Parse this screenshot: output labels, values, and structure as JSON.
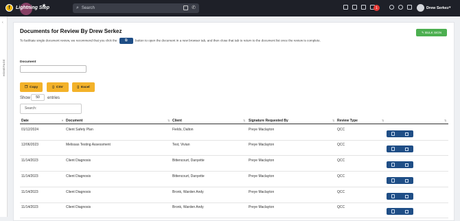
{
  "app": {
    "brand": "Lightning Step",
    "logo_letter": "f"
  },
  "search": {
    "placeholder": "Search"
  },
  "user": {
    "name": "Drew Serkez"
  },
  "notifications": {
    "count": "1"
  },
  "sidebar": {
    "label": "HOMEPAGE"
  },
  "page": {
    "title": "Documents for Review By Drew Serkez",
    "bulk_label": "BULK SIGN",
    "instruction_before": "To facilitate single document review, we recommend that you click the",
    "instruction_after": "button to open the document in a new browser tab, and then close that tab to return to the document list once the review is complete.",
    "document_label": "Document",
    "buttons": {
      "copy": "Copy",
      "csv": "CSV",
      "excel": "Excel"
    },
    "show_label": "Show",
    "show_value": "50",
    "entries_label": "entries",
    "table_search_label": "Search:"
  },
  "table": {
    "columns": [
      "Date",
      "Document",
      "Client",
      "Signature Requested By",
      "Review Type"
    ],
    "rows": [
      {
        "date": "01/12/2024",
        "document": "Client Safety Plan",
        "client": "Fields, Dalton",
        "requested_by": "Preye Maclayton",
        "review_type": "QCC"
      },
      {
        "date": "12/06/2023",
        "document": "Melissas Testing Assessment",
        "client": "Test, Vivian",
        "requested_by": "Preye Maclayton",
        "review_type": "QCC"
      },
      {
        "date": "11/14/2023",
        "document": "Client Diagnosis",
        "client": "Bittencourt, Danyette",
        "requested_by": "Preye Maclayton",
        "review_type": "QCC"
      },
      {
        "date": "11/14/2023",
        "document": "Client Diagnosis",
        "client": "Bittencourt, Danyette",
        "requested_by": "Preye Maclayton",
        "review_type": "QCC"
      },
      {
        "date": "11/14/2023",
        "document": "Client Diagnosis",
        "client": "Bronk, Warden Andy",
        "requested_by": "Preye Maclayton",
        "review_type": "QCC"
      },
      {
        "date": "11/14/2023",
        "document": "Client Diagnosis",
        "client": "Bronk, Warden Andy",
        "requested_by": "Preye Maclayton",
        "review_type": "QCC"
      }
    ]
  }
}
